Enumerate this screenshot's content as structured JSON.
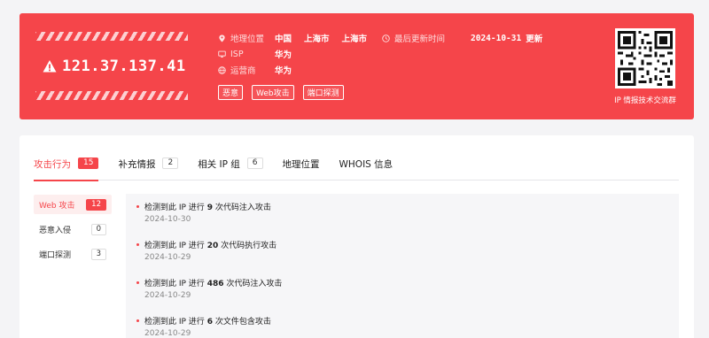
{
  "header": {
    "ip": "121.37.137.41",
    "location_label": "地理位置",
    "location_values": [
      "中国",
      "上海市",
      "上海市"
    ],
    "isp_label": "ISP",
    "isp_value": "华为",
    "operator_label": "运营商",
    "operator_value": "华为",
    "updated_label": "最后更新时间",
    "updated_date": "2024-10-31",
    "updated_suffix": "更新",
    "tags": [
      "恶意",
      "Web攻击",
      "端口探测"
    ],
    "qr_caption": "IP 情报技术交流群"
  },
  "tabs": [
    {
      "label": "攻击行为",
      "count": "15",
      "active": true
    },
    {
      "label": "补充情报",
      "count": "2"
    },
    {
      "label": "相关 IP 组",
      "count": "6"
    },
    {
      "label": "地理位置"
    },
    {
      "label": "WHOIS 信息"
    }
  ],
  "sidebar": [
    {
      "label": "Web 攻击",
      "count": "12",
      "active": true
    },
    {
      "label": "恶意入侵",
      "count": "0"
    },
    {
      "label": "端口探测",
      "count": "3"
    }
  ],
  "events": [
    {
      "prefix": "检测到此 IP 进行",
      "num": "9",
      "suffix": "次代码注入攻击",
      "date": "2024-10-30"
    },
    {
      "prefix": "检测到此 IP 进行",
      "num": "20",
      "suffix": "次代码执行攻击",
      "date": "2024-10-29"
    },
    {
      "prefix": "检测到此 IP 进行",
      "num": "486",
      "suffix": "次代码注入攻击",
      "date": "2024-10-29"
    },
    {
      "prefix": "检测到此 IP 进行",
      "num": "6",
      "suffix": "次文件包含攻击",
      "date": "2024-10-29"
    }
  ],
  "colors": {
    "accent": "#f5454a",
    "banner_bg": "#f5454a",
    "page_bg": "#f4f4f6"
  },
  "icons": [
    "warning-icon",
    "location-pin-icon",
    "monitor-icon",
    "globe-icon",
    "clock-icon",
    "qr-code-icon"
  ]
}
